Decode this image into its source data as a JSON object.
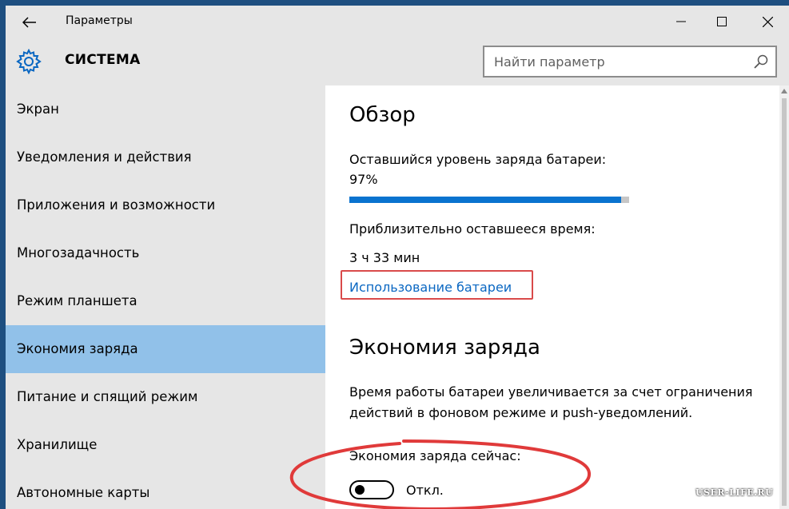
{
  "window": {
    "title": "Параметры"
  },
  "header": {
    "section_title": "СИСТЕМА",
    "section_icon": "gear-icon",
    "search_placeholder": "Найти параметр"
  },
  "sidebar": {
    "items": [
      {
        "label": "Экран",
        "active": false
      },
      {
        "label": "Уведомления и действия",
        "active": false
      },
      {
        "label": "Приложения и возможности",
        "active": false
      },
      {
        "label": "Многозадачность",
        "active": false
      },
      {
        "label": "Режим планшета",
        "active": false
      },
      {
        "label": "Экономия заряда",
        "active": true
      },
      {
        "label": "Питание и спящий режим",
        "active": false
      },
      {
        "label": "Хранилище",
        "active": false
      },
      {
        "label": "Автономные карты",
        "active": false
      }
    ]
  },
  "content": {
    "overview_title": "Обзор",
    "battery_level_label": "Оставшийся уровень заряда батареи:",
    "battery_level_value": "97%",
    "battery_level_fraction": 0.97,
    "remaining_time_label": "Приблизительно оставшееся время:",
    "remaining_time_value": "3 ч 33 мин",
    "battery_usage_link": "Использование батареи",
    "saver_title": "Экономия заряда",
    "saver_description": "Время работы батареи увеличивается за счет ограничения действий в фоновом режиме и push-уведомлений.",
    "saver_now_label": "Экономия заряда сейчас:",
    "saver_toggle_state": "Откл.",
    "saver_toggle_on": false
  },
  "colors": {
    "accent": "#0a73cf",
    "active_nav": "#91c1e9",
    "annotation": "#d94a4a",
    "link": "#0a67c2"
  },
  "watermark": "USER-LIFE.RU"
}
